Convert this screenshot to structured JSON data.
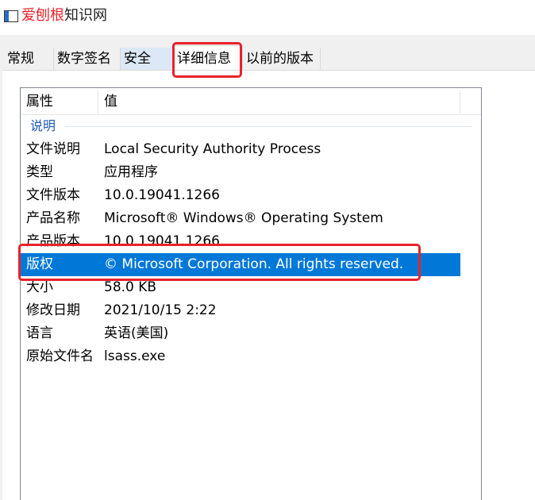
{
  "window": {
    "title_red": "爱刨根",
    "title_rest": "知识网"
  },
  "tabs": [
    {
      "label": "常规"
    },
    {
      "label": "数字签名"
    },
    {
      "label": "安全"
    },
    {
      "label": "详细信息"
    },
    {
      "label": "以前的版本"
    }
  ],
  "columns": {
    "property": "属性",
    "value": "值"
  },
  "group": {
    "label": "说明"
  },
  "rows": [
    {
      "key": "文件说明",
      "value": "Local Security Authority Process"
    },
    {
      "key": "类型",
      "value": "应用程序"
    },
    {
      "key": "文件版本",
      "value": "10.0.19041.1266"
    },
    {
      "key": "产品名称",
      "value": "Microsoft® Windows® Operating System"
    },
    {
      "key": "产品版本",
      "value": "10.0.19041.1266"
    },
    {
      "key": "版权",
      "value": "© Microsoft Corporation. All rights reserved."
    },
    {
      "key": "大小",
      "value": "58.0 KB"
    },
    {
      "key": "修改日期",
      "value": "2021/10/15 2:22"
    },
    {
      "key": "语言",
      "value": "英语(美国)"
    },
    {
      "key": "原始文件名",
      "value": "lsass.exe"
    }
  ],
  "selected_row": "版权",
  "colors": {
    "selection": "#0078d7",
    "annotation": "#e8222a",
    "group_label": "#1e5bb8"
  }
}
